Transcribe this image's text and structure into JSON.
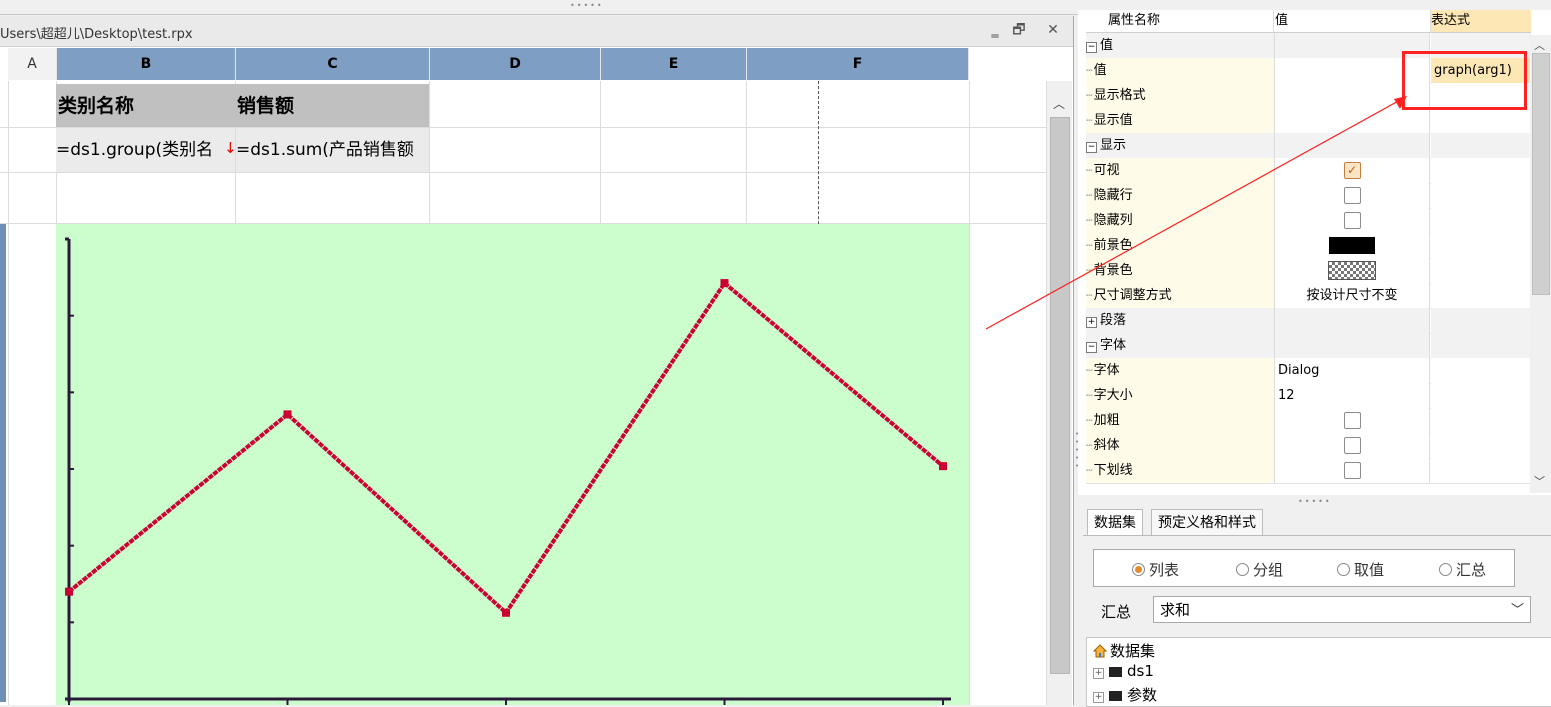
{
  "window": {
    "file_path": "Users\\超超儿\\Desktop\\test.rpx",
    "minimize_icon": "minimize-icon",
    "restore_icon": "restore-icon",
    "close_icon": "close-icon"
  },
  "columns": [
    {
      "label": "A",
      "selected": false
    },
    {
      "label": "B",
      "selected": true
    },
    {
      "label": "C",
      "selected": true
    },
    {
      "label": "D",
      "selected": true
    },
    {
      "label": "E",
      "selected": true
    },
    {
      "label": "F",
      "selected": true
    }
  ],
  "cells": {
    "b1": "类别名称",
    "c1": "销售额",
    "b2": "=ds1.group(类别名",
    "c2": "=ds1.sum(产品销售额"
  },
  "chart_data": {
    "type": "line",
    "title": "",
    "xlabel": "",
    "ylabel": "",
    "x": [
      0,
      1,
      2,
      3,
      4
    ],
    "series": [
      {
        "color": "#cc0033",
        "values": [
          112,
          297,
          90,
          434,
          243
        ]
      }
    ],
    "ylim": [
      0,
      480
    ],
    "grid": false,
    "tick_labels": false,
    "colors": {
      "line": "#cc0033",
      "axis": "#2a1a3a",
      "background": "#ccfdcc"
    }
  },
  "properties": {
    "headers": {
      "name": "属性名称",
      "value": "值",
      "expr": "表达式"
    },
    "rows": [
      {
        "type": "group",
        "name": "值",
        "value": "",
        "expr": "",
        "expanded": true
      },
      {
        "type": "leaf",
        "name": "值",
        "value": "",
        "expr": "graph(arg1)"
      },
      {
        "type": "leaf",
        "name": "显示格式",
        "value": "",
        "expr": ""
      },
      {
        "type": "leaf",
        "name": "显示值",
        "value": "",
        "expr": ""
      },
      {
        "type": "group",
        "name": "显示",
        "value": "",
        "expr": "",
        "expanded": true
      },
      {
        "type": "leaf",
        "name": "可视",
        "value": "",
        "expr": "",
        "widget": "checkbox",
        "checked": true
      },
      {
        "type": "leaf",
        "name": "隐藏行",
        "value": "",
        "expr": "",
        "widget": "checkbox",
        "checked": false
      },
      {
        "type": "leaf",
        "name": "隐藏列",
        "value": "",
        "expr": "",
        "widget": "checkbox",
        "checked": false
      },
      {
        "type": "leaf",
        "name": "前景色",
        "value": "",
        "expr": "",
        "widget": "color",
        "color": "#000000"
      },
      {
        "type": "leaf",
        "name": "背景色",
        "value": "",
        "expr": "",
        "widget": "color-transparent"
      },
      {
        "type": "leaf",
        "name": "尺寸调整方式",
        "value": "按设计尺寸不变",
        "expr": "",
        "center": true
      },
      {
        "type": "group",
        "name": "段落",
        "value": "",
        "expr": "",
        "expanded": false
      },
      {
        "type": "group",
        "name": "字体",
        "value": "",
        "expr": "",
        "expanded": true
      },
      {
        "type": "leaf",
        "name": "字体",
        "value": "Dialog",
        "expr": ""
      },
      {
        "type": "leaf",
        "name": "字大小",
        "value": "12",
        "expr": ""
      },
      {
        "type": "leaf",
        "name": "加粗",
        "value": "",
        "expr": "",
        "widget": "checkbox",
        "checked": false
      },
      {
        "type": "leaf",
        "name": "斜体",
        "value": "",
        "expr": "",
        "widget": "checkbox",
        "checked": false
      },
      {
        "type": "leaf",
        "name": "下划线",
        "value": "",
        "expr": "",
        "widget": "checkbox",
        "checked": false
      }
    ],
    "highlight_color": "#ff2222"
  },
  "bottom": {
    "tabs": [
      "数据集",
      "预定义格和样式"
    ],
    "modes": [
      {
        "label": "列表",
        "checked": true
      },
      {
        "label": "分组",
        "checked": false
      },
      {
        "label": "取值",
        "checked": false
      },
      {
        "label": "汇总",
        "checked": false
      }
    ],
    "aggregate_label": "汇总",
    "aggregate_value": "求和",
    "tree": {
      "root": "数据集",
      "items": [
        "ds1",
        "参数"
      ]
    }
  }
}
